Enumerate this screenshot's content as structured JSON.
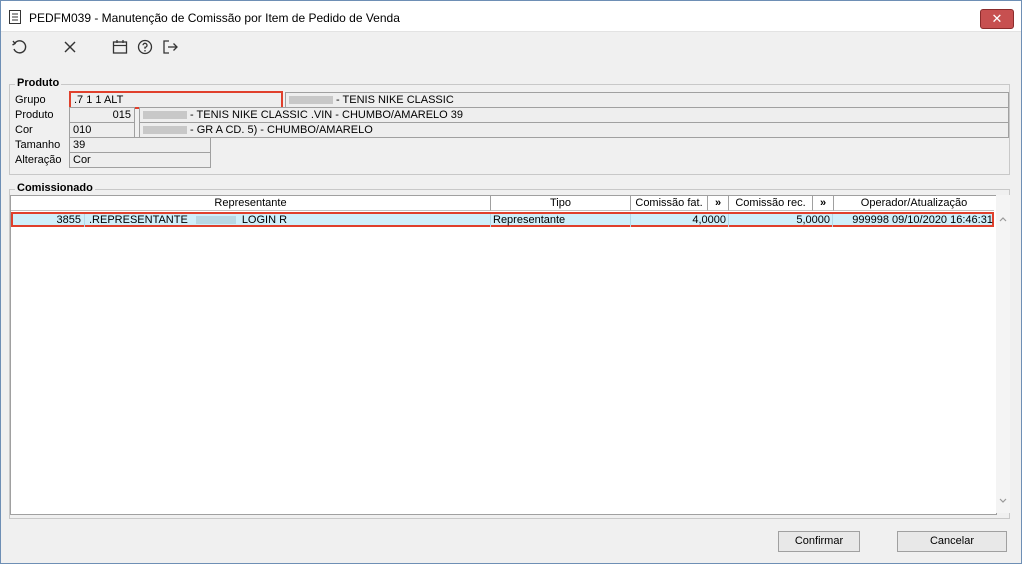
{
  "window": {
    "title": "PEDFM039 - Manutenção de Comissão por Item de Pedido de Venda",
    "close_label": "✕"
  },
  "toolbar": {
    "icons": [
      "refresh-icon",
      "close-icon",
      "calendar-icon",
      "help-icon",
      "exit-icon"
    ]
  },
  "produto": {
    "section_label": "Produto",
    "grupo_label": "Grupo",
    "grupo_value": ".7 1 1 ALT",
    "grupo_desc": "- TENIS NIKE CLASSIC",
    "produto_label": "Produto",
    "produto_code": "015",
    "produto_desc": "- TENIS NIKE CLASSIC .VIN - CHUMBO/AMARELO 39",
    "cor_label": "Cor",
    "cor_value": "010",
    "cor_desc": "- GR A CD. 5) - CHUMBO/AMARELO",
    "tamanho_label": "Tamanho",
    "tamanho_value": "39",
    "alteracao_label": "Alteração",
    "alteracao_value": "Cor"
  },
  "comissionado": {
    "section_label": "Comissionado",
    "columns": {
      "representante": "Representante",
      "tipo": "Tipo",
      "comissao_fat": "Comissão fat.",
      "comissao_rec": "Comissão rec.",
      "more": "»",
      "operador": "Operador/Atualização"
    },
    "rows": [
      {
        "codigo": "3855",
        "representante": ".REPRESENTANTE",
        "representante_suffix": "LOGIN R",
        "tipo": "Representante",
        "comissao_fat": "4,0000",
        "comissao_rec": "5,0000",
        "operador": "999998",
        "atualizacao": "09/10/2020 16:46:31"
      }
    ]
  },
  "buttons": {
    "confirmar": "Confirmar",
    "cancelar": "Cancelar"
  },
  "colors": {
    "selection": "#cfeffa",
    "highlight_border": "#e0402c",
    "close": "#c75050"
  }
}
